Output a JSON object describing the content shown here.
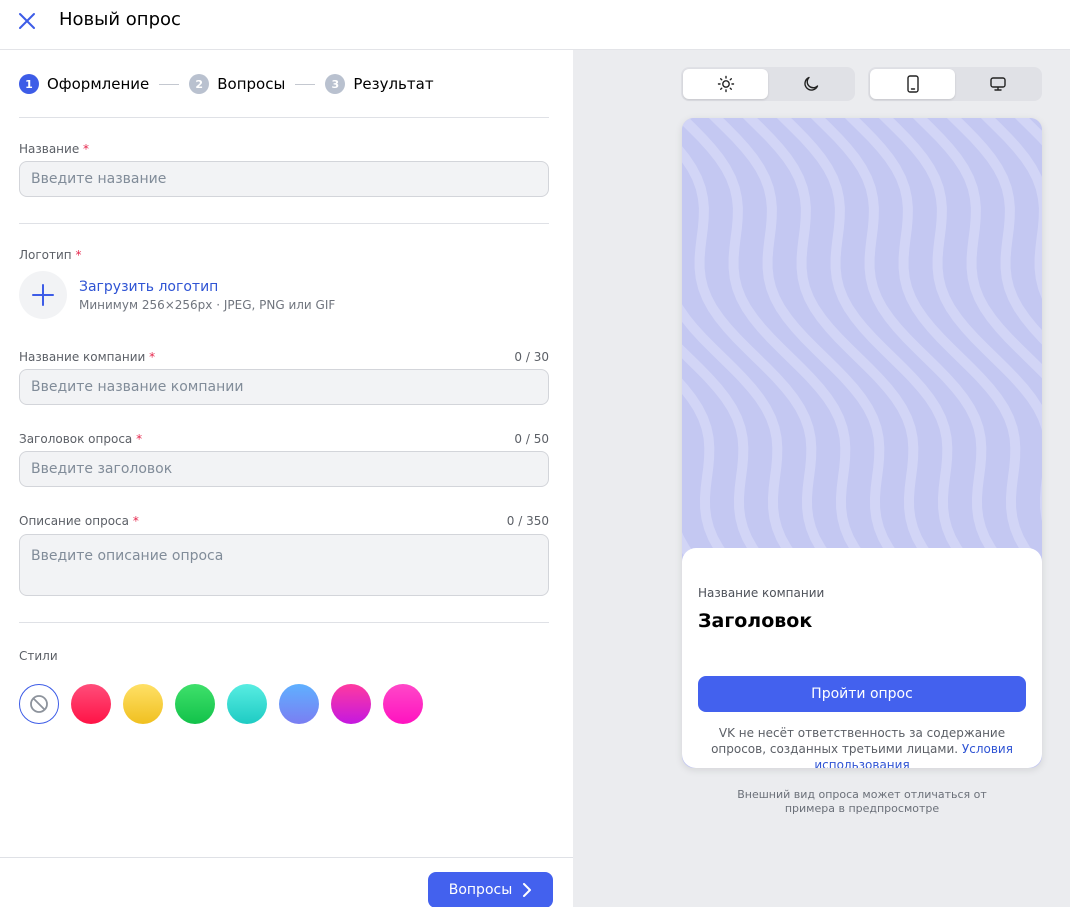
{
  "header": {
    "title": "Новый опрос",
    "close_icon": "close-icon"
  },
  "steps": [
    {
      "num": "1",
      "label": "Оформление",
      "active": true
    },
    {
      "num": "2",
      "label": "Вопросы",
      "active": false
    },
    {
      "num": "3",
      "label": "Результат",
      "active": false
    }
  ],
  "form": {
    "name": {
      "label": "Название",
      "required_mark": "*",
      "placeholder": "Введите название",
      "value": ""
    },
    "logo": {
      "label": "Логотип",
      "required_mark": "*",
      "upload_label": "Загрузить логотип",
      "hint": "Минимум 256×256px · JPEG, PNG или GIF"
    },
    "company": {
      "label": "Название компании",
      "required_mark": "*",
      "counter": "0 / 30",
      "placeholder": "Введите название компании",
      "value": ""
    },
    "heading": {
      "label": "Заголовок опроса",
      "required_mark": "*",
      "counter": "0 / 50",
      "placeholder": "Введите заголовок",
      "value": ""
    },
    "description": {
      "label": "Описание опроса",
      "required_mark": "*",
      "counter": "0 / 350",
      "placeholder": "Введите описание опроса",
      "value": ""
    },
    "styles": {
      "label": "Стили",
      "swatches": [
        {
          "name": "none",
          "selected": true
        },
        {
          "name": "red",
          "colors": [
            "#ff4d7a",
            "#ff1346"
          ]
        },
        {
          "name": "yellow",
          "colors": [
            "#ffe066",
            "#f0c020"
          ]
        },
        {
          "name": "green",
          "colors": [
            "#3fe06b",
            "#12c24a"
          ]
        },
        {
          "name": "teal",
          "colors": [
            "#58ede2",
            "#1ecbc3"
          ]
        },
        {
          "name": "blue",
          "colors": [
            "#5fb0ff",
            "#7a7ef2"
          ]
        },
        {
          "name": "magenta",
          "colors": [
            "#ff3aa0",
            "#c418e0"
          ]
        },
        {
          "name": "pink",
          "colors": [
            "#ff48c8",
            "#ff12c0"
          ]
        }
      ]
    }
  },
  "footer": {
    "next_label": "Вопросы"
  },
  "preview": {
    "theme_toggle": {
      "light_icon": "sun-icon",
      "dark_icon": "moon-icon",
      "selected": "light"
    },
    "device_toggle": {
      "mobile_icon": "phone-icon",
      "desktop_icon": "monitor-icon",
      "selected": "mobile"
    },
    "background_color": "#c4c8f2",
    "card": {
      "company": "Название компании",
      "title": "Заголовок",
      "button": "Пройти опрос",
      "note_text": "VK не несёт ответственность за содержание опросов, созданных третьими лицами.",
      "note_link": "Условия использования"
    },
    "note": "Внешний вид опроса может отличаться от примера в предпросмотре"
  },
  "colors": {
    "accent": "#4361ee",
    "required": "#e6274d",
    "link": "#2f54d4"
  }
}
